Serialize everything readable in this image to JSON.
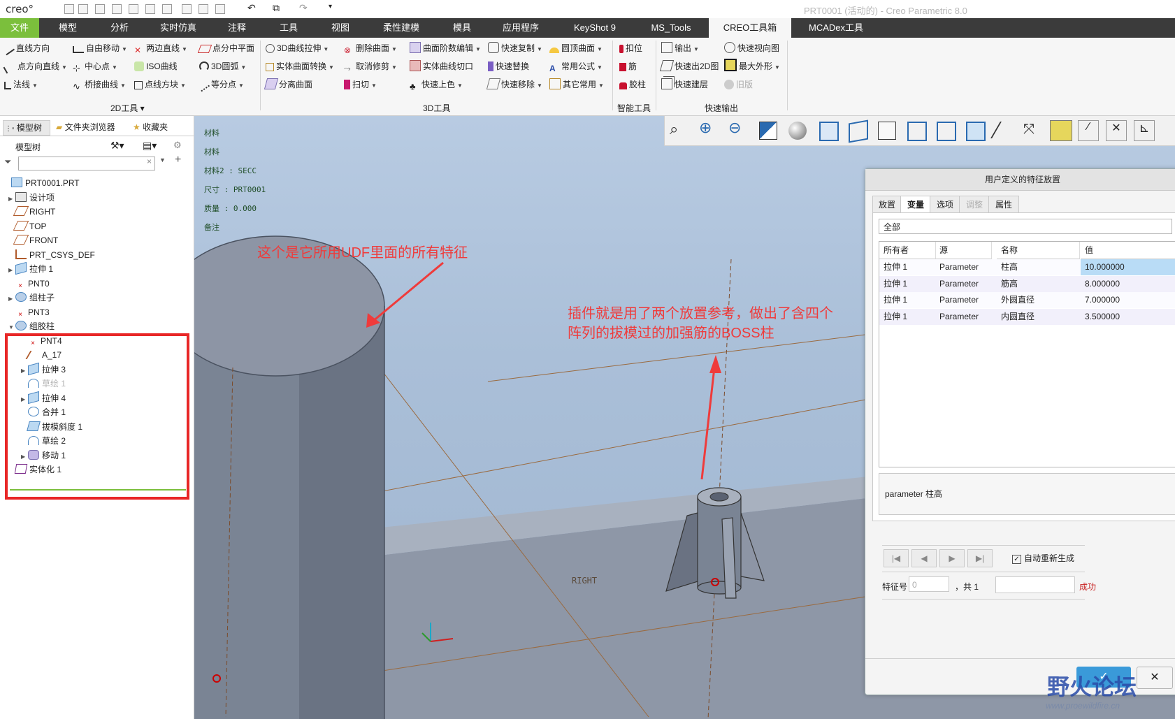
{
  "app": {
    "logo": "creo°",
    "window_title": "PRT0001 (活动的) - Creo Parametric 8.0"
  },
  "tabs": [
    {
      "label": "文件"
    },
    {
      "label": "模型"
    },
    {
      "label": "分析"
    },
    {
      "label": "实时仿真"
    },
    {
      "label": "注释"
    },
    {
      "label": "工具"
    },
    {
      "label": "视图"
    },
    {
      "label": "柔性建模"
    },
    {
      "label": "模具"
    },
    {
      "label": "应用程序"
    },
    {
      "label": "KeyShot 9"
    },
    {
      "label": "MS_Tools"
    },
    {
      "label": "CREO工具箱"
    },
    {
      "label": "MCADex工具"
    }
  ],
  "ribbon": {
    "tools2d": [
      "直线方向",
      "自由移动",
      "两边直线",
      "点分中平面",
      "点方向直线",
      "中心点",
      "ISO曲线",
      "3D圆弧",
      "法线",
      "桥接曲线",
      "点线方块",
      "等分点"
    ],
    "tools2d_label": "2D工具",
    "tools3d": [
      "3D曲线拉伸",
      "删除曲面",
      "曲面阶数编辑",
      "快速复制",
      "圆顶曲面",
      "实体曲面转换",
      "取消修剪",
      "实体曲线切口",
      "快速替换",
      "常用公式",
      "分离曲面",
      "扫切",
      "快速上色",
      "快速移除",
      "其它常用"
    ],
    "tools3d_label": "3D工具",
    "smart": [
      "扣位",
      "筋",
      "胶柱"
    ],
    "smart_label": "智能工具",
    "export": [
      "输出",
      "快速视向图",
      "快速出2D图",
      "最大外形",
      "快速建层",
      "旧版"
    ],
    "export_label": "快速输出"
  },
  "left_panel": {
    "tabs": [
      "模型树",
      "文件夹浏览器",
      "收藏夹"
    ],
    "header": "模型树",
    "search_placeholder": "",
    "tree": [
      {
        "label": "PRT0001.PRT",
        "level": 0,
        "arrow": "",
        "icon": "part-icon"
      },
      {
        "label": "设计项",
        "level": 1,
        "arrow": "▶",
        "icon": "design-items-icon"
      },
      {
        "label": "RIGHT",
        "level": 1,
        "arrow": "",
        "icon": "datum-plane-icon"
      },
      {
        "label": "TOP",
        "level": 1,
        "arrow": "",
        "icon": "datum-plane-icon"
      },
      {
        "label": "FRONT",
        "level": 1,
        "arrow": "",
        "icon": "datum-plane-icon"
      },
      {
        "label": "PRT_CSYS_DEF",
        "level": 1,
        "arrow": "",
        "icon": "csys-icon"
      },
      {
        "label": "拉伸 1",
        "level": 1,
        "arrow": "▶",
        "icon": "extrude-icon"
      },
      {
        "label": "PNT0",
        "level": 1,
        "arrow": "",
        "icon": "datum-point-icon"
      },
      {
        "label": "组柱子",
        "level": 1,
        "arrow": "▶",
        "icon": "group-icon"
      },
      {
        "label": "PNT3",
        "level": 1,
        "arrow": "",
        "icon": "datum-point-icon"
      },
      {
        "label": "组胶柱",
        "level": 1,
        "arrow": "▼",
        "icon": "group-icon"
      },
      {
        "label": "PNT4",
        "level": 2,
        "arrow": "",
        "icon": "datum-point-icon"
      },
      {
        "label": "A_17",
        "level": 2,
        "arrow": "",
        "icon": "axis-icon"
      },
      {
        "label": "拉伸 3",
        "level": 2,
        "arrow": "▶",
        "icon": "extrude-icon"
      },
      {
        "label": "草绘 1",
        "level": 2,
        "arrow": "",
        "icon": "sketch-icon",
        "dim": true
      },
      {
        "label": "拉伸 4",
        "level": 2,
        "arrow": "▶",
        "icon": "extrude-icon"
      },
      {
        "label": "合并 1",
        "level": 2,
        "arrow": "",
        "icon": "merge-icon"
      },
      {
        "label": "拔模斜度 1",
        "level": 2,
        "arrow": "",
        "icon": "draft-icon"
      },
      {
        "label": "草绘 2",
        "level": 2,
        "arrow": "",
        "icon": "sketch-icon"
      },
      {
        "label": "移动 1",
        "level": 2,
        "arrow": "▶",
        "icon": "move-icon"
      },
      {
        "label": "实体化 1",
        "level": 1,
        "arrow": "",
        "icon": "solidify-icon"
      }
    ]
  },
  "viewport": {
    "info_lines": [
      "材料",
      "材料",
      "材料2 :   SECC",
      "尺寸 :   PRT0001",
      "质量 :  0.000",
      "备注"
    ],
    "plane_label": "RIGHT"
  },
  "annotations": {
    "left": "这个是它所用UDF里面的所有特征",
    "right_line1": "插件就是用了两个放置参考，做出了含四个",
    "right_line2": "阵列的拔模过的加强筋的BOSS柱"
  },
  "dialog": {
    "title": "用户定义的特征放置",
    "tabs": [
      {
        "label": "放置",
        "state": "normal"
      },
      {
        "label": "变量",
        "state": "active"
      },
      {
        "label": "选项",
        "state": "normal"
      },
      {
        "label": "调整",
        "state": "disabled"
      },
      {
        "label": "属性",
        "state": "normal"
      }
    ],
    "filter": "全部",
    "columns": [
      "所有者",
      "源",
      "名称",
      "值"
    ],
    "rows": [
      [
        "拉伸 1",
        "Parameter",
        "柱高",
        "10.000000"
      ],
      [
        "拉伸 1",
        "Parameter",
        "筋高",
        "8.000000"
      ],
      [
        "拉伸 1",
        "Parameter",
        "外圆直径",
        "7.000000"
      ],
      [
        "拉伸 1",
        "Parameter",
        "内圆直径",
        "3.500000"
      ]
    ],
    "description": "parameter 柱高",
    "auto_regen": "自动重新生成",
    "feature_no_label": "特征号",
    "feature_no_value": "0",
    "total": "，共 1",
    "status": "成功",
    "ok_label": "✓",
    "close_label": "✕"
  },
  "watermark": {
    "brand": "野火论坛",
    "url": "www.proewildfire.cn"
  }
}
